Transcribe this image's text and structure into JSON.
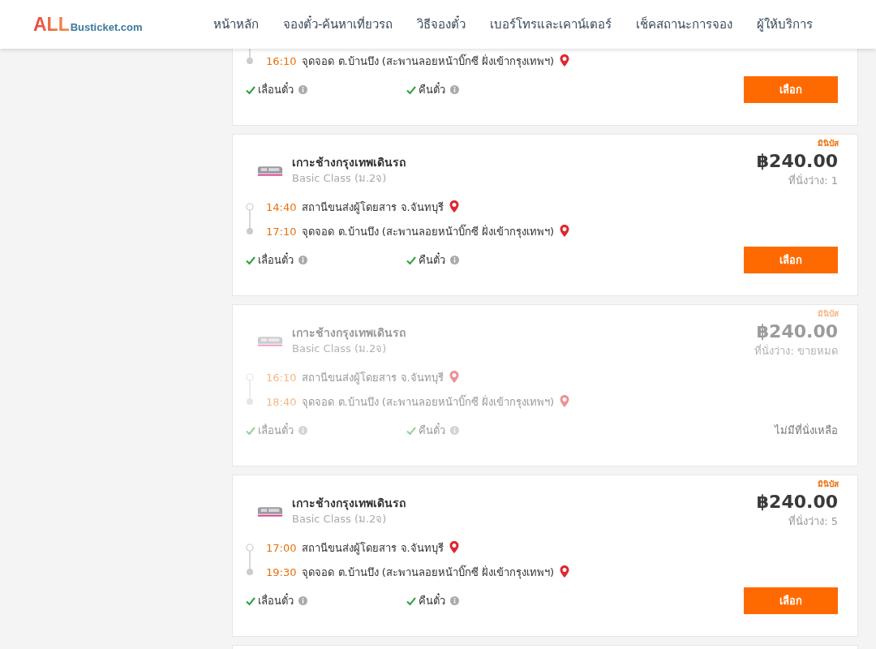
{
  "header": {
    "logo": {
      "brand": "ALL",
      "domain": "Busticket.com"
    },
    "nav": [
      {
        "label": "หน้าหลัก"
      },
      {
        "label": "จองตั๋ว-ค้นหาเที่ยวรถ"
      },
      {
        "label": "วิธีจองตั๋ว"
      },
      {
        "label": "เบอร์โทรและเคาน์เตอร์"
      },
      {
        "label": "เช็คสถานะการจอง"
      },
      {
        "label": "ผู้ให้บริการ"
      }
    ]
  },
  "trips": [
    {
      "sold_out": false,
      "stops": [
        {
          "kind": "arrive",
          "time": "16:10",
          "place": "จุดจอด ต.บ้านบึง (สะพานลอยหน้าบิ๊กซี ฝั่งเข้ากรุงเทพฯ)"
        }
      ],
      "features": [
        "เลื่อนตั๋ว",
        "คืนตั๋ว"
      ],
      "button": "เลือก"
    },
    {
      "sold_out": false,
      "tag": "มินิบัส",
      "operator": "เกาะช้างกรุงเทพเดินรถ",
      "bus_class": "Basic Class (ม.2จ)",
      "price": "฿240.00",
      "seats": "ที่นั่งว่าง: 1",
      "stops": [
        {
          "kind": "depart",
          "time": "14:40",
          "place": "สถานีขนส่งผู้โดยสาร จ.จันทบุรี"
        },
        {
          "kind": "arrive",
          "time": "17:10",
          "place": "จุดจอด ต.บ้านบึง (สะพานลอยหน้าบิ๊กซี ฝั่งเข้ากรุงเทพฯ)"
        }
      ],
      "features": [
        "เลื่อนตั๋ว",
        "คืนตั๋ว"
      ],
      "button": "เลือก"
    },
    {
      "sold_out": true,
      "tag": "มินิบัส",
      "operator": "เกาะช้างกรุงเทพเดินรถ",
      "bus_class": "Basic Class (ม.2จ)",
      "price": "฿240.00",
      "seats": "ที่นั่งว่าง: ขายหมด",
      "stops": [
        {
          "kind": "depart",
          "time": "16:10",
          "place": "สถานีขนส่งผู้โดยสาร จ.จันทบุรี"
        },
        {
          "kind": "arrive",
          "time": "18:40",
          "place": "จุดจอด ต.บ้านบึง (สะพานลอยหน้าบิ๊กซี ฝั่งเข้ากรุงเทพฯ)"
        }
      ],
      "features": [
        "เลื่อนตั๋ว",
        "คืนตั๋ว"
      ],
      "notice": "ไม่มีที่นั่งเหลือ"
    },
    {
      "sold_out": false,
      "tag": "มินิบัส",
      "operator": "เกาะช้างกรุงเทพเดินรถ",
      "bus_class": "Basic Class (ม.2จ)",
      "price": "฿240.00",
      "seats": "ที่นั่งว่าง: 5",
      "stops": [
        {
          "kind": "depart",
          "time": "17:00",
          "place": "สถานีขนส่งผู้โดยสาร จ.จันทบุรี"
        },
        {
          "kind": "arrive",
          "time": "19:30",
          "place": "จุดจอด ต.บ้านบึง (สะพานลอยหน้าบิ๊กซี ฝั่งเข้ากรุงเทพฯ)"
        }
      ],
      "features": [
        "เลื่อนตั๋ว",
        "คืนตั๋ว"
      ],
      "button": "เลือก"
    }
  ]
}
